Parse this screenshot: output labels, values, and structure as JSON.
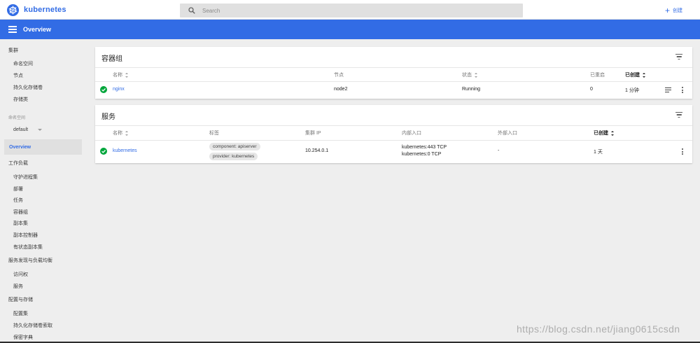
{
  "app": {
    "name": "kubernetes"
  },
  "search": {
    "placeholder": "Search"
  },
  "header": {
    "create_label": "创建"
  },
  "toolbar": {
    "title": "Overview"
  },
  "colors": {
    "brand": "#326ce5",
    "success": "#00a63b"
  },
  "sidebar": {
    "cluster": {
      "heading": "集群",
      "items": [
        "命名空间",
        "节点",
        "持久化存储卷",
        "存储类"
      ]
    },
    "namespace": {
      "heading": "命名空间",
      "selected": "default"
    },
    "active_item": "Overview",
    "workloads": {
      "heading": "工作负载",
      "items": [
        "守护进程集",
        "部署",
        "任务",
        "容器组",
        "副本集",
        "副本控制器",
        "有状态副本集"
      ]
    },
    "discovery": {
      "heading": "服务发现与负载均衡",
      "items": [
        "访问权",
        "服务"
      ]
    },
    "config": {
      "heading": "配置与存储",
      "items": [
        "配置集",
        "持久化存储卷索取",
        "保密字典"
      ]
    }
  },
  "pods": {
    "title": "容器组",
    "columns": {
      "name": "名称",
      "node": "节点",
      "status": "状态",
      "restarts": "已重启",
      "created": "已创建"
    },
    "rows": [
      {
        "status_icon": "check-circle-icon",
        "name": "nginx",
        "node": "node2",
        "status": "Running",
        "restarts": "0",
        "created": "1 分钟"
      }
    ]
  },
  "services": {
    "title": "服务",
    "columns": {
      "name": "名称",
      "labels": "标签",
      "cluster_ip": "集群 IP",
      "internal_endpoints": "内部入口",
      "external_endpoints": "外部入口",
      "created": "已创建"
    },
    "rows": [
      {
        "status_icon": "check-circle-icon",
        "name": "kubernetes",
        "labels": [
          "component: apiserver",
          "provider: kubernetes"
        ],
        "cluster_ip": "10.254.0.1",
        "internal_endpoints": [
          "kubernetes:443 TCP",
          "kubernetes:0 TCP"
        ],
        "external_endpoints": "-",
        "created": "1 天"
      }
    ]
  },
  "watermark": "https://blog.csdn.net/jiang0615csdn"
}
